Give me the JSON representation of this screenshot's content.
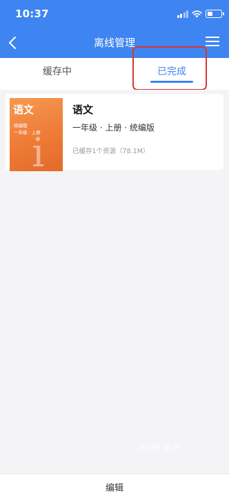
{
  "status_bar": {
    "time": "10:37",
    "icons": [
      "signal-icon",
      "wifi-icon",
      "battery-icon"
    ],
    "battery_level": 0.3
  },
  "nav": {
    "title": "离线管理",
    "back_icon": "chevron-left-icon",
    "menu_icon": "menu-icon"
  },
  "tabs": [
    {
      "label": "缓存中",
      "active": false
    },
    {
      "label": "已完成",
      "active": true
    }
  ],
  "items": [
    {
      "title": "语文",
      "meta": "一年级 · 上册 · 统编版",
      "cache_info": "已缓存1个资源（78.1M）",
      "cover": {
        "title": "语文",
        "line1": "统编版",
        "line2": "一年级 · 上册",
        "color": "#ee7b36"
      }
    }
  ],
  "bottom": {
    "edit_label": "编辑"
  },
  "watermark": "ROM 助手",
  "colors": {
    "primary": "#3f85f1",
    "highlight_box": "#d9362e",
    "background": "#f4f4f6"
  }
}
